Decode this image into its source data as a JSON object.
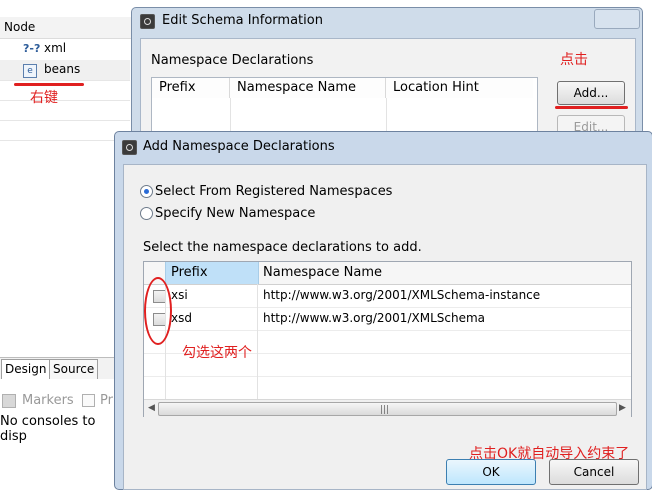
{
  "background": {
    "node_header": "Node",
    "tree": [
      {
        "icon": "xml-declaration-icon",
        "glyph": "?-?",
        "label": "xml"
      },
      {
        "icon": "element-icon",
        "glyph": "e",
        "label": "beans"
      }
    ],
    "bottom_tabs": [
      "Design",
      "Source"
    ],
    "markers_label": "Markers",
    "markers_extra": "Pr",
    "console_text": "No consoles to disp"
  },
  "schema_dialog": {
    "title": "Edit Schema Information",
    "section_label": "Namespace Declarations",
    "columns": [
      "Prefix",
      "Namespace Name",
      "Location Hint"
    ],
    "add_label": "Add...",
    "edit_label": "Edit..."
  },
  "add_dialog": {
    "title": "Add Namespace Declarations",
    "radio_registered": "Select From Registered Namespaces",
    "radio_new": "Specify New Namespace",
    "hint": "Select the namespace declarations to add.",
    "columns": [
      "Prefix",
      "Namespace Name"
    ],
    "rows": [
      {
        "prefix": "xsi",
        "namespace": "http://www.w3.org/2001/XMLSchema-instance",
        "checked": false
      },
      {
        "prefix": "xsd",
        "namespace": "http://www.w3.org/2001/XMLSchema",
        "checked": false
      }
    ],
    "ok_label": "OK",
    "cancel_label": "Cancel"
  },
  "annotations": {
    "right_click": "右键",
    "click": "点击",
    "select_both": "勾选这两个",
    "click_ok": "点击OK就自动导入约束了",
    "color": "#e02020"
  }
}
